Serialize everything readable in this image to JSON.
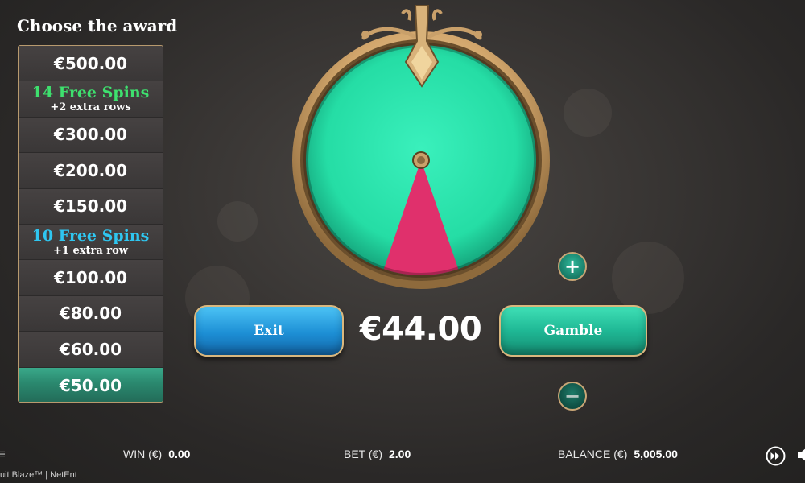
{
  "award_panel": {
    "title": "Choose the award",
    "items": [
      {
        "main": "€500.00",
        "sub": "",
        "style": "plain",
        "selected": false
      },
      {
        "main": "14 Free Spins",
        "sub": "+2 extra rows",
        "style": "green",
        "selected": false
      },
      {
        "main": "€300.00",
        "sub": "",
        "style": "plain",
        "selected": false
      },
      {
        "main": "€200.00",
        "sub": "",
        "style": "plain",
        "selected": false
      },
      {
        "main": "€150.00",
        "sub": "",
        "style": "plain",
        "selected": false
      },
      {
        "main": "10 Free Spins",
        "sub": "+1 extra row",
        "style": "cyan",
        "selected": false
      },
      {
        "main": "€100.00",
        "sub": "",
        "style": "plain",
        "selected": false
      },
      {
        "main": "€80.00",
        "sub": "",
        "style": "plain",
        "selected": false
      },
      {
        "main": "€60.00",
        "sub": "",
        "style": "plain",
        "selected": false
      },
      {
        "main": "€50.00",
        "sub": "",
        "style": "plain",
        "selected": true
      }
    ]
  },
  "wheel": {
    "win_segment_fraction": 0.105,
    "colors": {
      "base": "#2ee8b0",
      "win_segment": "#e0306c",
      "rim": "#d8b27a"
    }
  },
  "controls": {
    "exit_label": "Exit",
    "gamble_label": "Gamble",
    "stake": "€44.00",
    "increase_symbol": "+",
    "decrease_symbol": "−"
  },
  "status_bar": {
    "win_label": "WIN (€)",
    "win_value": "0.00",
    "bet_label": "BET (€)",
    "bet_value": "2.00",
    "balance_label": "BALANCE (€)",
    "balance_value": "5,005.00",
    "brand": "uit Blaze™  |  NetEnt",
    "menu_glyph": "≡"
  },
  "icons": {
    "fast_forward": "fast-forward-icon",
    "sound": "sound-icon"
  }
}
